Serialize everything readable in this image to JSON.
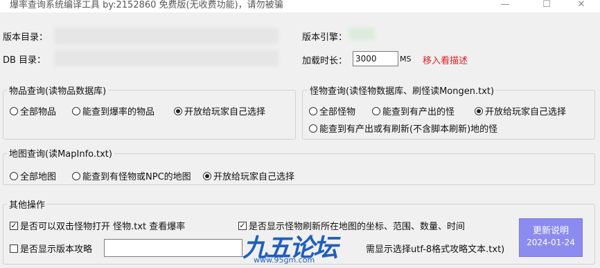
{
  "window": {
    "title": "爆率查询系统编译工具 by:2152860 免费版(无收费功能)，请勿被骗",
    "minimize_glyph": "—",
    "maximize_glyph": "☐",
    "close_glyph": "✕"
  },
  "top": {
    "version_dir_label": "版本目录：",
    "db_dir_label": "DB 目录：",
    "engine_label": "版本引擎：",
    "load_time_label": "加载时长：",
    "load_time_value": "3000",
    "load_time_unit": "MS",
    "hover_hint": "移入看描述",
    "hover_hint_color": "#e02020"
  },
  "items_group": {
    "title": "物品查询(读物品数据库)",
    "options": [
      "全部物品",
      "能查到爆率的物品",
      "开放给玩家自己选择"
    ],
    "selected": 2
  },
  "monster_group": {
    "title": "怪物查询(读怪物数据库、刷怪读Mongen.txt)",
    "options": [
      "全部怪物",
      "能查到有产出的怪",
      "开放给玩家自己选择",
      "能查到有产出或有刷新(不含脚本刷新)地的怪"
    ],
    "selected": 2
  },
  "map_group": {
    "title": "地图查询(读MapInfo.txt)",
    "options": [
      "全部地图",
      "能查到有怪物或NPC的地图",
      "开放给玩家自己选择"
    ],
    "selected": 2
  },
  "other_group": {
    "title": "其他操作",
    "check1_label": "是否可以双击怪物打开 怪物.txt 查看爆率",
    "check1_checked": true,
    "check2_label": "是否显示怪物刷新所在地图的坐标、范围、数量、时间",
    "check2_checked": true,
    "check3_label": "是否显示版本攻略",
    "check3_checked": false,
    "check3_hint": "需显示选择utf-8格式攻略文本.txt)",
    "update_button_label": "更新说明",
    "update_button_date": "2024-01-24",
    "check_glyph": "✓"
  },
  "watermark": {
    "logo_text": "九五论坛",
    "url": "www.95gm.com"
  }
}
